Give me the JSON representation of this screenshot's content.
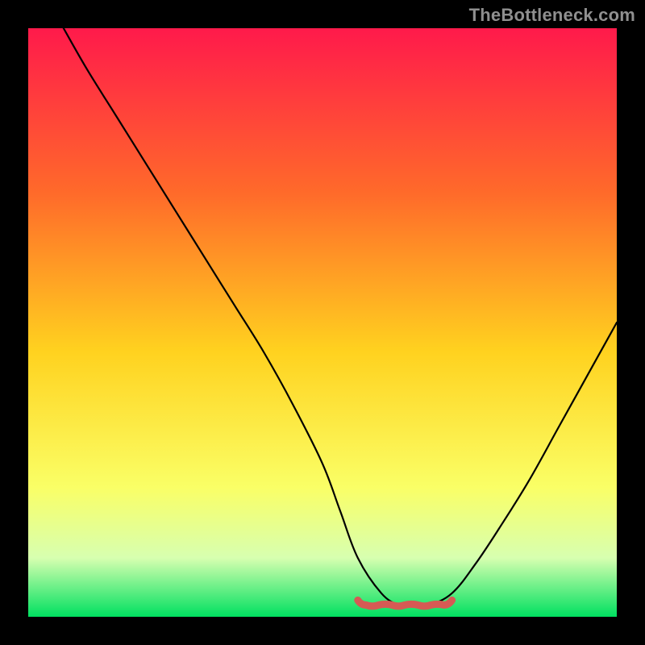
{
  "watermark": "TheBottleneck.com",
  "colors": {
    "black": "#000000",
    "gradient_top": "#ff1a4b",
    "gradient_mid1": "#ff6a2a",
    "gradient_mid2": "#ffd21f",
    "gradient_mid3": "#faff66",
    "gradient_mid4": "#d7ffb0",
    "gradient_bottom": "#00e060",
    "curve": "#000000",
    "bottom_accent": "#d65a54"
  },
  "chart_data": {
    "type": "line",
    "title": "",
    "xlabel": "",
    "ylabel": "",
    "xlim": [
      0,
      100
    ],
    "ylim": [
      0,
      100
    ],
    "series": [
      {
        "name": "bottleneck-curve",
        "x": [
          6,
          10,
          15,
          20,
          25,
          30,
          35,
          40,
          45,
          50,
          53,
          56,
          60,
          63,
          65,
          68,
          72,
          76,
          80,
          85,
          90,
          95,
          100
        ],
        "y": [
          100,
          93,
          85,
          77,
          69,
          61,
          53,
          45,
          36,
          26,
          18,
          10,
          4,
          2,
          2,
          2,
          4,
          9,
          15,
          23,
          32,
          41,
          50
        ]
      }
    ],
    "annotations": [
      {
        "name": "valley-accent",
        "x_start": 56,
        "x_end": 72,
        "y": 2
      }
    ]
  }
}
